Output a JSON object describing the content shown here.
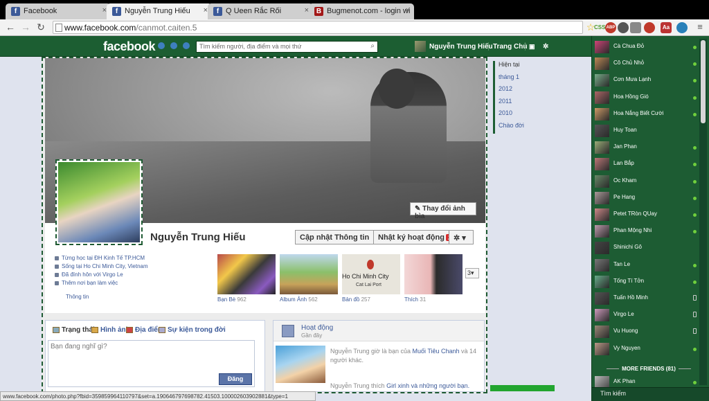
{
  "browser": {
    "tabs": [
      {
        "title": "Facebook",
        "icon": "facebook-favicon"
      },
      {
        "title": "Nguyễn Trung Hiếu",
        "icon": "facebook-favicon"
      },
      {
        "title": "Q Ueen Rắc Rối",
        "icon": "facebook-favicon"
      },
      {
        "title": "Bugmenot.com - login wi",
        "icon": "bugmenot-favicon"
      }
    ],
    "url_domain": "www.facebook.com",
    "url_path": "/canmot.caiten.5",
    "status_url": "www.facebook.com/photo.php?fbid=359859964110797&set=a.190646797698782.41503.100002603902881&type=1",
    "extensions": [
      "CSS",
      "ABP"
    ]
  },
  "header": {
    "logo": "facebook",
    "search_placeholder": "Tìm kiếm người, địa điểm và mọi thứ",
    "user_name": "Nguyễn Trung Hiếu",
    "home": "Trang Chủ"
  },
  "profile": {
    "name": "Nguyễn Trung Hiếu",
    "change_cover": "Thay đổi ảnh bìa",
    "update_info": "Cập nhật Thông tin",
    "activity_log": "Nhật ký hoạt động",
    "activity_badge": "2",
    "about": [
      "Từng học tại ĐH Kinh Tế TP.HCM",
      "Sống tại Ho Chi Minh City, Vietnam",
      "Đã đính hôn với Virgo Le",
      "Thêm nơi bạn làm việc"
    ],
    "about_link": "Thông tin",
    "tiles": [
      {
        "label": "Bạn Bè",
        "count": "962"
      },
      {
        "label": "Album Ảnh",
        "count": "562"
      },
      {
        "label": "Bản đồ",
        "count": "257"
      },
      {
        "label": "Thích",
        "count": "31"
      }
    ],
    "map_label": "Ho Chi Minh City",
    "map_sublabel": "Cat Lai Port",
    "more_tiles": "3"
  },
  "composer": {
    "tabs": [
      "Trạng thái",
      "Hình ảnh",
      "Địa điểm",
      "Sự kiện trong đời"
    ],
    "placeholder": "Bạn đang nghĩ gì?",
    "post_button": "Đăng"
  },
  "activity": {
    "title": "Hoạt động",
    "subtitle": "Gần đây",
    "items": [
      {
        "prefix": "Nguyễn Trung giờ là bạn của ",
        "link": "Muối Tiêu Chanh",
        "suffix": " và 14 người khác."
      },
      {
        "prefix": "Nguyễn Trung thích ",
        "link": "Girl xinh và những người bạn.",
        "suffix": ""
      }
    ]
  },
  "timeline": [
    "Hiện tại",
    "tháng 1",
    "2012",
    "2011",
    "2010",
    "Chào đời"
  ],
  "chat": {
    "friends": [
      {
        "name": "Cà Chua Đỏ",
        "status": "online"
      },
      {
        "name": "Cô Chủ Nhỏ",
        "status": "online"
      },
      {
        "name": "Cơn Mưa Lạnh",
        "status": "online"
      },
      {
        "name": "Hoa Hồng Gió",
        "status": "online"
      },
      {
        "name": "Hoa Nắng Biết Cười",
        "status": "online"
      },
      {
        "name": "Huy Toan",
        "status": "none"
      },
      {
        "name": "Jan Phan",
        "status": "online"
      },
      {
        "name": "Lan Bắp",
        "status": "online"
      },
      {
        "name": "Oc Kham",
        "status": "online"
      },
      {
        "name": "Pe Hang",
        "status": "online"
      },
      {
        "name": "Petet TRòn QUay",
        "status": "online"
      },
      {
        "name": "Phan Mộng Nhi",
        "status": "online"
      },
      {
        "name": "Shinichi Gô",
        "status": "none"
      },
      {
        "name": "Tan Le",
        "status": "online"
      },
      {
        "name": "Tống Tí Tởn",
        "status": "online"
      },
      {
        "name": "Tuấn Hồ Minh",
        "status": "mobile"
      },
      {
        "name": "Virgo Le",
        "status": "mobile"
      },
      {
        "name": "Vu Huong",
        "status": "mobile"
      },
      {
        "name": "Vy Nguyen",
        "status": "online"
      }
    ],
    "more_friends": "MORE FRIENDS (81)",
    "extra_friend": {
      "name": "AK Phan",
      "status": "online"
    },
    "search": "Tìm kiếm"
  },
  "colors": {
    "header_bg": "#1c5e32",
    "chat_bg": "#1d5c33",
    "link": "#3b5998",
    "online": "#6fcf3d"
  }
}
